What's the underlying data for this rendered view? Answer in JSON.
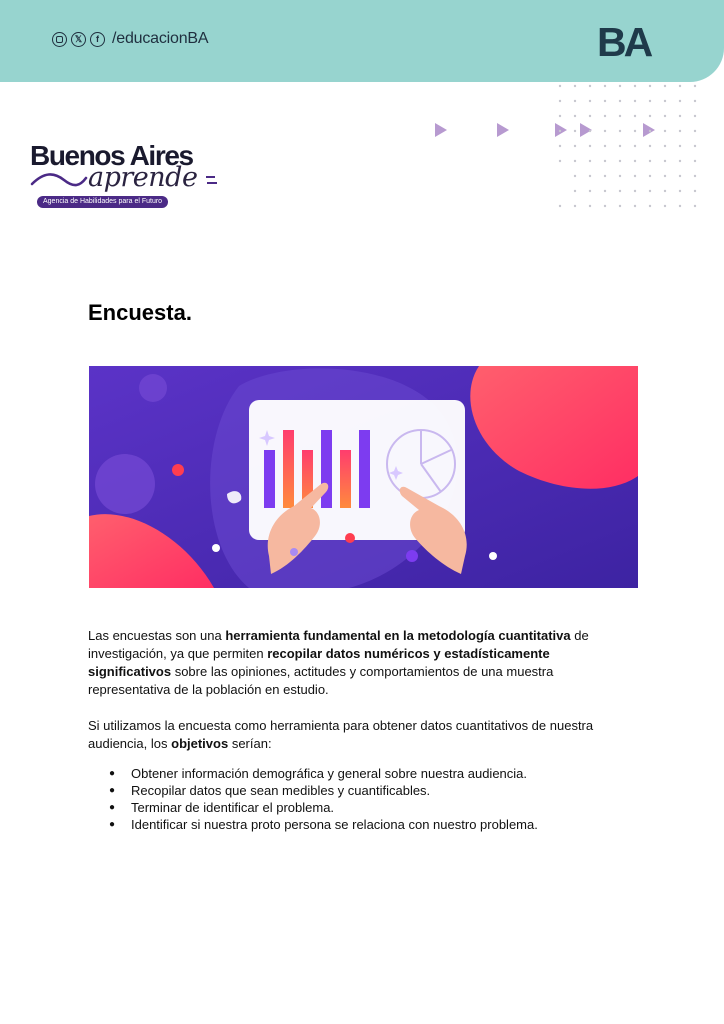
{
  "header": {
    "social_icons": [
      "instagram-icon",
      "x-icon",
      "facebook-icon"
    ],
    "x_glyph": "𝕏",
    "facebook_glyph": "f",
    "handle": "/educacionBA",
    "logo_text": "BA",
    "band_color": "#97d4cf",
    "logo_color": "#1f3a4a"
  },
  "brand": {
    "main": "Buenos Aires",
    "script": "aprende",
    "tagline": "Agencia de Habilidades para el Futuro",
    "accent_color": "#4b2a86"
  },
  "title": "Encuesta.",
  "paragraphs": {
    "p1": {
      "t1": "Las encuestas son una ",
      "b1": "herramienta fundamental en la metodología cuantitativa",
      "t2": " de investigación, ya que permiten ",
      "b2": "recopilar datos numéricos y estadísticamente significativos",
      "t3": " sobre las opiniones, actitudes y comportamientos de una muestra representativa de la población en estudio."
    },
    "p2": {
      "t1": "Si utilizamos la encuesta como herramienta para obtener datos cuantitativos de nuestra audiencia, los ",
      "b1": "objetivos",
      "t2": " serían:"
    }
  },
  "bullets": [
    "Obtener información demográfica y general sobre nuestra audiencia.",
    "Recopilar datos que sean medibles y cuantificables.",
    "Terminar de identificar el problema.",
    "Identificar si nuestra proto persona se relaciona con nuestro problema."
  ]
}
